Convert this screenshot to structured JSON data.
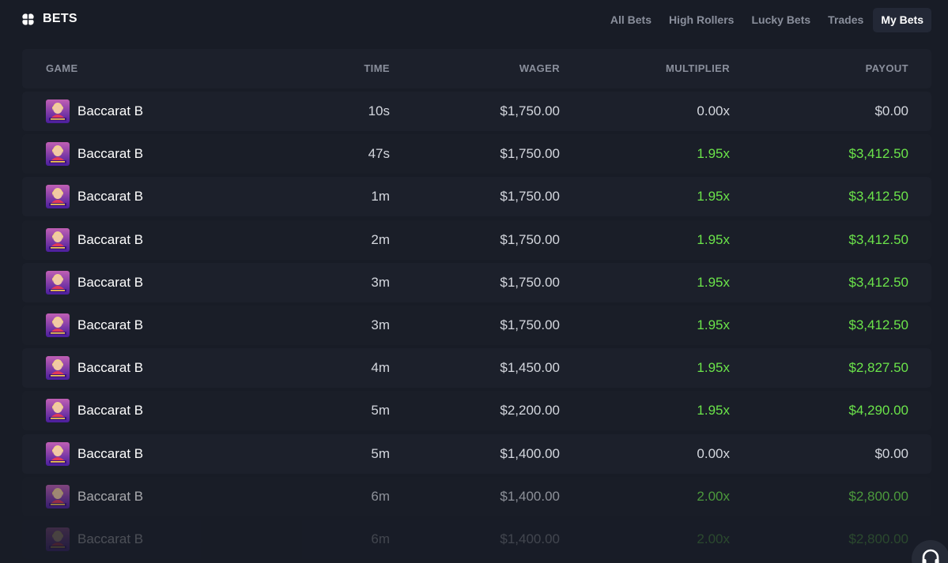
{
  "header": {
    "title": "BETS",
    "tabs": [
      "All Bets",
      "High Rollers",
      "Lucky Bets",
      "Trades",
      "My Bets"
    ],
    "active_tab": "My Bets"
  },
  "table": {
    "columns": {
      "game": "GAME",
      "time": "TIME",
      "wager": "WAGER",
      "multiplier": "MULTIPLIER",
      "payout": "PAYOUT"
    },
    "rows": [
      {
        "game": "Baccarat B",
        "time": "10s",
        "wager": "$1,750.00",
        "multiplier": "0.00x",
        "payout": "$0.00",
        "win": false
      },
      {
        "game": "Baccarat B",
        "time": "47s",
        "wager": "$1,750.00",
        "multiplier": "1.95x",
        "payout": "$3,412.50",
        "win": true
      },
      {
        "game": "Baccarat B",
        "time": "1m",
        "wager": "$1,750.00",
        "multiplier": "1.95x",
        "payout": "$3,412.50",
        "win": true
      },
      {
        "game": "Baccarat B",
        "time": "2m",
        "wager": "$1,750.00",
        "multiplier": "1.95x",
        "payout": "$3,412.50",
        "win": true
      },
      {
        "game": "Baccarat B",
        "time": "3m",
        "wager": "$1,750.00",
        "multiplier": "1.95x",
        "payout": "$3,412.50",
        "win": true
      },
      {
        "game": "Baccarat B",
        "time": "3m",
        "wager": "$1,750.00",
        "multiplier": "1.95x",
        "payout": "$3,412.50",
        "win": true
      },
      {
        "game": "Baccarat B",
        "time": "4m",
        "wager": "$1,450.00",
        "multiplier": "1.95x",
        "payout": "$2,827.50",
        "win": true
      },
      {
        "game": "Baccarat B",
        "time": "5m",
        "wager": "$2,200.00",
        "multiplier": "1.95x",
        "payout": "$4,290.00",
        "win": true
      },
      {
        "game": "Baccarat B",
        "time": "5m",
        "wager": "$1,400.00",
        "multiplier": "0.00x",
        "payout": "$0.00",
        "win": false
      },
      {
        "game": "Baccarat B",
        "time": "6m",
        "wager": "$1,400.00",
        "multiplier": "2.00x",
        "payout": "$2,800.00",
        "win": true
      },
      {
        "game": "Baccarat B",
        "time": "6m",
        "wager": "$1,400.00",
        "multiplier": "2.00x",
        "payout": "$2,800.00",
        "win": true
      }
    ]
  },
  "colors": {
    "background": "#181c26",
    "row": "#1c202b",
    "win_green": "#6be44a",
    "muted_text": "#8a8f9c"
  },
  "icons": {
    "brand": "clover-icon",
    "game_thumbnail": "baccarat-thumbnail-icon",
    "support": "headset-icon"
  }
}
